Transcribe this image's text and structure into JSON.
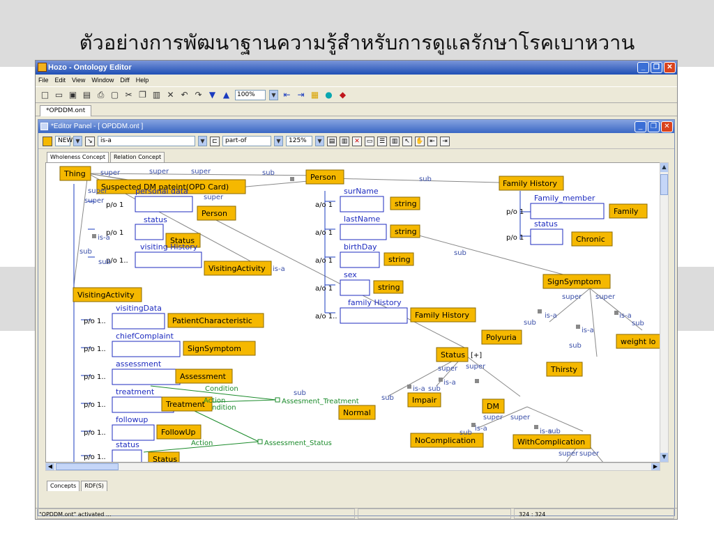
{
  "slide": {
    "title": "ตัวอย่างการพัฒนาฐานความรู้สำหรับการดูแลรักษาโรคเบาหวาน"
  },
  "window": {
    "title": "Hozo - Ontology Editor"
  },
  "menu": [
    "File",
    "Edit",
    "View",
    "Window",
    "Diff",
    "Help"
  ],
  "toolbar": {
    "zoom": "100%"
  },
  "file_tab": "*OPDDM.ont",
  "editor": {
    "title": "*Editor Panel - [ OPDDM.ont ]",
    "new_label": "NEW",
    "is_a": "is-a",
    "part_of": "part-of",
    "zoom": "125%"
  },
  "concept_tabs": [
    "Wholeness Concept",
    "Relation Concept"
  ],
  "bottom_tabs": [
    "Concepts",
    "RDF(S)"
  ],
  "status": {
    "message": "\"OPDDM.ont\" activated ...",
    "coords": "324 : 324"
  },
  "colors": {
    "concept_fill": "#f5b800",
    "slot_border": "#1d2bbf",
    "edge_blue": "#3a4fa8",
    "edge_green": "#1a8a2a",
    "edge_gray": "#888888"
  },
  "diagram": {
    "concepts": [
      "Thing",
      "Suspected DM pateint(OPD Card)",
      "Person",
      "Family History",
      "Person",
      "Status",
      "VisitingActivity",
      "string",
      "string",
      "string",
      "string",
      "Family",
      "Chronic",
      "SignSymptom",
      "VisitingActivity",
      "PatientCharacteristic",
      "Family History",
      "Polyuria",
      "weight lo",
      "SignSymptom",
      "Status",
      "Thirsty",
      "Assessment",
      "Impair",
      "Normal",
      "DM",
      "Treatment",
      "FollowUp",
      "NoComplication",
      "WithComplication",
      "Status"
    ],
    "slot_names": [
      "personal data",
      "status",
      "visiting History",
      "surName",
      "lastName",
      "birthDay",
      "sex",
      "family History",
      "Family_member",
      "status",
      "visitingData",
      "chiefComplaint",
      "assessment",
      "treatment",
      "followup",
      "status"
    ],
    "cardinalities": [
      "p/o 1",
      "p/o 1",
      "p/o 1..",
      "a/o 1",
      "a/o 1",
      "a/o 1",
      "a/o 1",
      "a/o 1..",
      "p/o 1",
      "p/o 1",
      "p/o 1..",
      "p/o 1..",
      "p/o 1..",
      "p/o 1..",
      "p/o 1..",
      "p/o 1.."
    ],
    "labels": [
      "super",
      "super",
      "super",
      "sub",
      "sub",
      "super",
      "super",
      "is-a",
      "sub",
      "is-a",
      "sub",
      "super",
      "super",
      "is-a",
      "sub",
      "is-a",
      "sub",
      "is-a",
      "sub",
      "super",
      "super",
      "is-a",
      "sub",
      "is-a",
      "sub",
      "Condition",
      "Action",
      "ndition",
      "Action",
      "Assesment_Treatment",
      "Assessment_Status",
      "super",
      "super",
      "is-a",
      "sub",
      "[+]",
      "super",
      "super",
      "super",
      "sub",
      "is-a",
      "sub",
      "sub"
    ]
  }
}
